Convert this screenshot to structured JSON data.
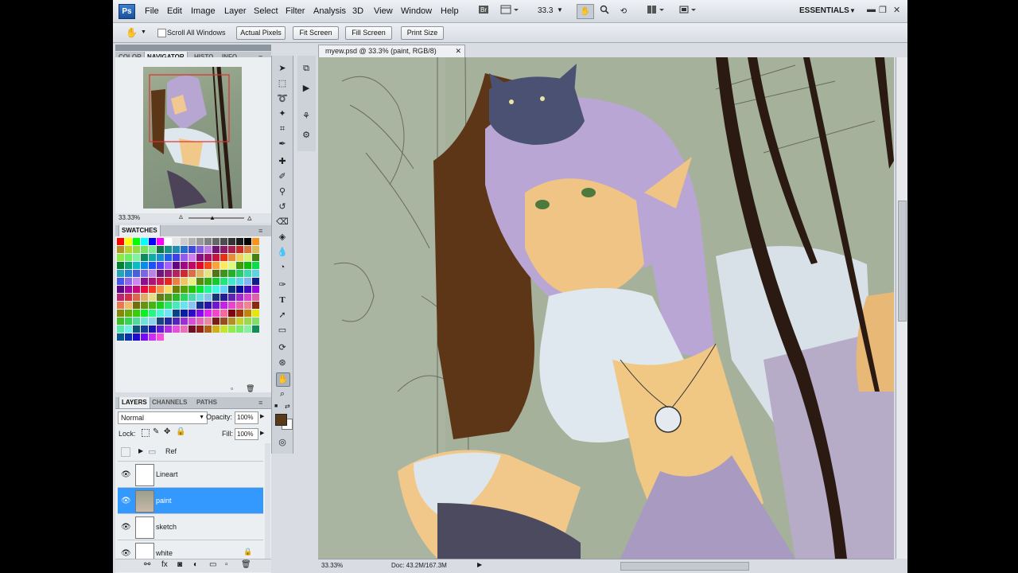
{
  "app": {
    "logo": "Ps",
    "workspace": "ESSENTIALS",
    "zoom_label": "33.3"
  },
  "menu": [
    "File",
    "Edit",
    "Image",
    "Layer",
    "Select",
    "Filter",
    "Analysis",
    "3D",
    "View",
    "Window",
    "Help"
  ],
  "options": {
    "scroll_all_windows": "Scroll All Windows",
    "actual_pixels": "Actual Pixels",
    "fit_screen": "Fit Screen",
    "fill_screen": "Fill Screen",
    "print_size": "Print Size"
  },
  "panels": {
    "top_tabs": [
      "COLOR",
      "NAVIGATOR",
      "HISTO",
      "INFO"
    ],
    "navigator_zoom": "33.33%",
    "swatches_title": "SWATCHES",
    "layer_tabs": [
      "LAYERS",
      "CHANNELS",
      "PATHS"
    ],
    "blend_mode": "Normal",
    "opacity_label": "Opacity:",
    "opacity_value": "100%",
    "lock_label": "Lock:",
    "fill_label": "Fill:",
    "fill_value": "100%"
  },
  "layers": [
    {
      "name": "Ref",
      "type": "group",
      "visible": false,
      "selected": false
    },
    {
      "name": "Lineart",
      "type": "layer",
      "visible": true,
      "selected": false
    },
    {
      "name": "paint",
      "type": "layer",
      "visible": true,
      "selected": true
    },
    {
      "name": "sketch",
      "type": "layer",
      "visible": true,
      "selected": false
    },
    {
      "name": "white",
      "type": "layer",
      "visible": true,
      "selected": false,
      "locked": true
    }
  ],
  "document": {
    "tab_title": "myew.psd @ 33.3% (paint, RGB/8)",
    "status_zoom": "33.33%",
    "status_doc": "Doc: 43.2M/167.3M"
  },
  "colors": {
    "foreground": "#5a3a1a",
    "background": "#ffffff",
    "selection": "#3399ff"
  }
}
